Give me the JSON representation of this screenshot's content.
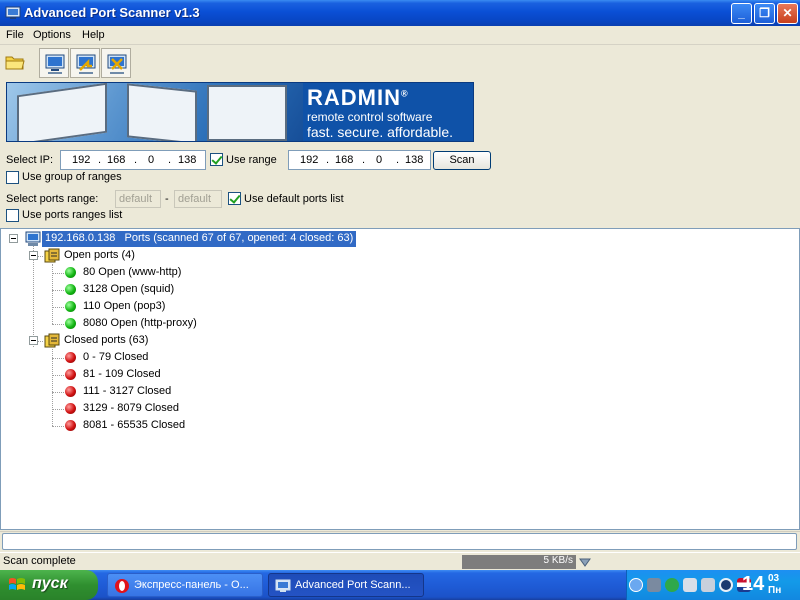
{
  "window": {
    "title": "Advanced Port Scanner v1.3",
    "minimize": "_",
    "maximize": "❐",
    "close": "✕"
  },
  "menu": [
    "File",
    "Options",
    "Help"
  ],
  "banner": {
    "brand": "RADMIN",
    "reg": "®",
    "line1": "remote control software",
    "line2": "fast. secure. affordable."
  },
  "form": {
    "select_ip_label": "Select IP:",
    "ip_start": [
      "192",
      "168",
      "0",
      "138"
    ],
    "use_range_label": "Use range",
    "use_range_checked": true,
    "ip_end": [
      "192",
      "168",
      "0",
      "138"
    ],
    "scan_label": "Scan",
    "use_group_label": "Use group of ranges",
    "use_group_checked": false,
    "ports_range_label": "Select ports range:",
    "port_from": "default",
    "port_sep": "-",
    "port_to": "default",
    "use_default_ports_label": "Use default ports list",
    "use_default_ports_checked": true,
    "use_ports_ranges_label": "Use ports ranges list",
    "use_ports_ranges_checked": false
  },
  "tree": {
    "host": "192.168.0.138",
    "host_summary": "Ports (scanned 67 of 67, opened: 4 closed: 63)",
    "open_group": "Open ports (4)",
    "open_ports": [
      "80 Open (www-http)",
      "3128 Open (squid)",
      "110 Open (pop3)",
      "8080 Open (http-proxy)"
    ],
    "closed_group": "Closed ports (63)",
    "closed_ports": [
      "0 - 79 Closed",
      "81 - 109 Closed",
      "111 - 3127 Closed",
      "3129 - 8079 Closed",
      "8081 - 65535 Closed"
    ]
  },
  "status": {
    "text": "Scan complete",
    "speed": "5 KB/s"
  },
  "taskbar": {
    "start": "пуск",
    "tasks": [
      "Экспресс-панель - О...",
      "Advanced Port Scann..."
    ],
    "clock_hour": "14",
    "clock_min": "03",
    "clock_day": "Пн"
  },
  "colors": {
    "open": "#12b512",
    "closed": "#d01010",
    "selection": "#316ac5"
  }
}
